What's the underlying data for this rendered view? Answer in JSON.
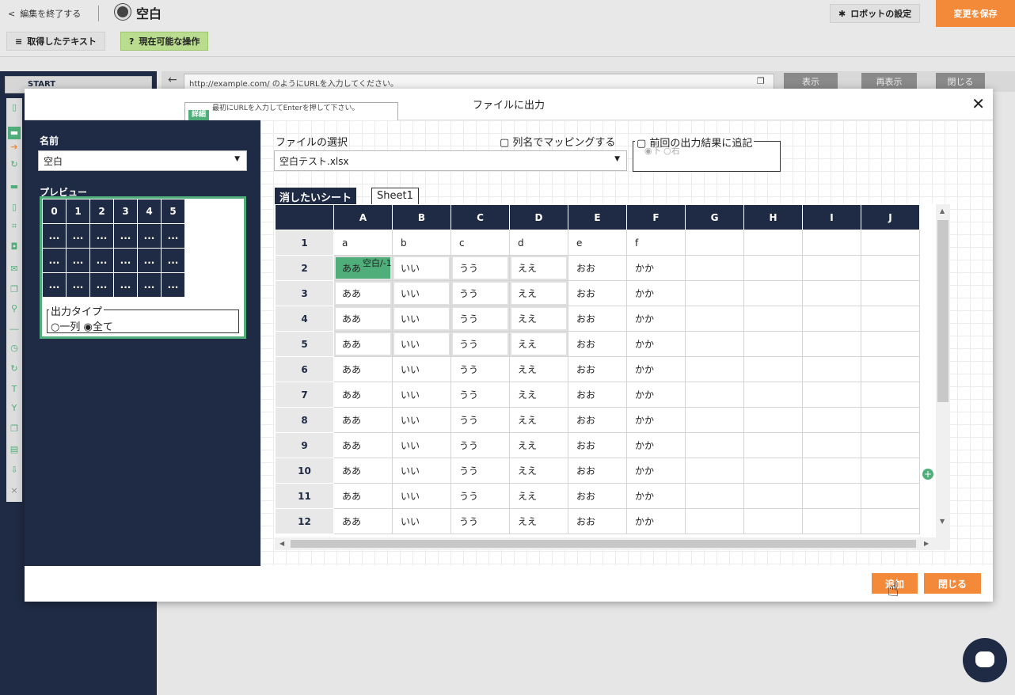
{
  "header": {
    "back_label": "編集を終了する",
    "title": "空白",
    "settings_label": "ロボットの設定",
    "save_label": "変更を保存",
    "text_button": "取得したテキスト",
    "ops_button": "現在可能な操作"
  },
  "sidebar": {
    "start_label": "START"
  },
  "urlbar": {
    "placeholder": "http://example.com/ のようにURLを入力してください。",
    "show_label": "表示",
    "reload_label": "再表示",
    "close_label": "閉じる"
  },
  "tooltip": {
    "badge": "詳細",
    "text": "最初にURLを入力してEnterを押して下さい。"
  },
  "modal": {
    "title": "ファイルに出力",
    "name_label": "名前",
    "name_value": "空白",
    "preview_label": "プレビュー",
    "preview_header": [
      "0",
      "1",
      "2",
      "3",
      "4",
      "5"
    ],
    "preview_dots": "...",
    "output_type_label": "出力タイプ",
    "output_type_options": "○一列 ◉全て",
    "file_label": "ファイルの選択",
    "file_value": "空白テスト.xlsx",
    "map_by_column": "▢ 列名でマッピングする",
    "append_label": "▢ 前回の出力結果に追記",
    "append_options": "◉下 ○右",
    "tabs": [
      "消したいシート",
      "Sheet1"
    ],
    "columns": [
      "",
      "A",
      "B",
      "C",
      "D",
      "E",
      "F",
      "G",
      "H",
      "I",
      "J"
    ],
    "rows": [
      {
        "n": "1",
        "cells": [
          "a",
          "b",
          "c",
          "d",
          "e",
          "f"
        ]
      },
      {
        "n": "2",
        "cells": [
          "ああ",
          "いい",
          "うう",
          "ええ",
          "おお",
          "かか"
        ]
      },
      {
        "n": "3",
        "cells": [
          "ああ",
          "いい",
          "うう",
          "ええ",
          "おお",
          "かか"
        ]
      },
      {
        "n": "4",
        "cells": [
          "ああ",
          "いい",
          "うう",
          "ええ",
          "おお",
          "かか"
        ]
      },
      {
        "n": "5",
        "cells": [
          "ああ",
          "いい",
          "うう",
          "ええ",
          "おお",
          "かか"
        ]
      },
      {
        "n": "6",
        "cells": [
          "ああ",
          "いい",
          "うう",
          "ええ",
          "おお",
          "かか"
        ]
      },
      {
        "n": "7",
        "cells": [
          "ああ",
          "いい",
          "うう",
          "ええ",
          "おお",
          "かか"
        ]
      },
      {
        "n": "8",
        "cells": [
          "ああ",
          "いい",
          "うう",
          "ええ",
          "おお",
          "かか"
        ]
      },
      {
        "n": "9",
        "cells": [
          "ああ",
          "いい",
          "うう",
          "ええ",
          "おお",
          "かか"
        ]
      },
      {
        "n": "10",
        "cells": [
          "ああ",
          "いい",
          "うう",
          "ええ",
          "おお",
          "かか"
        ]
      },
      {
        "n": "11",
        "cells": [
          "ああ",
          "いい",
          "うう",
          "ええ",
          "おお",
          "かか"
        ]
      },
      {
        "n": "12",
        "cells": [
          "ああ",
          "いい",
          "うう",
          "ええ",
          "おお",
          "かか"
        ]
      }
    ],
    "selected_cell_tag": "空白/-1",
    "add_button": "追加",
    "close_button": "閉じる"
  },
  "colors": {
    "navy": "#1f2a44",
    "green": "#4fae79",
    "orange": "#f28a3a"
  }
}
